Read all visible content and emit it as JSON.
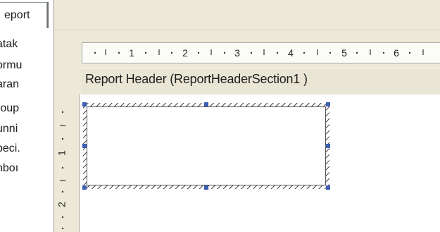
{
  "explorer": {
    "tab_label": "eport",
    "items": [
      {
        "label": "atak"
      },
      {
        "label": "ormu"
      },
      {
        "label": "aran"
      },
      {
        "label": "roup"
      },
      {
        "label": "unni"
      },
      {
        "label": "peci."
      },
      {
        "label": "nboı"
      }
    ]
  },
  "ruler": {
    "horizontal_numbers": [
      "1",
      "2",
      "3",
      "4",
      "5",
      "6"
    ],
    "vertical_numbers": [
      "1",
      "2"
    ]
  },
  "section": {
    "title": "Report Header  (ReportHeaderSection1 )"
  },
  "colors": {
    "window_bg": "#ece9d8",
    "handle_blue": "#3b5fb3",
    "hatch": "#3a3a3a"
  }
}
